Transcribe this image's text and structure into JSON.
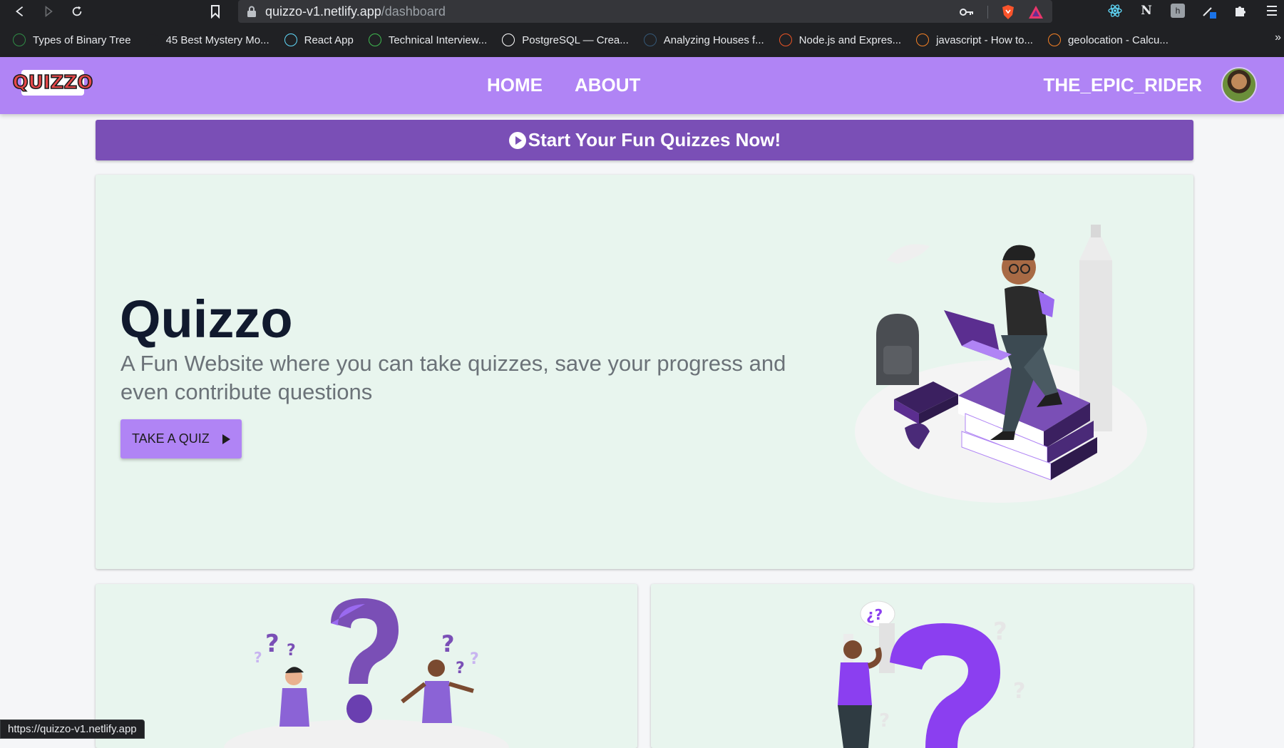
{
  "browser": {
    "url_host": "quizzo-v1.netlify.app",
    "url_path": "/dashboard",
    "bookmarks": [
      {
        "label": "Types of Binary Tree",
        "icon": "gfg-icon",
        "color": "#2f8d46"
      },
      {
        "label": "45 Best Mystery Mo...",
        "icon": "g-icon",
        "color": "#202124"
      },
      {
        "label": "React App",
        "icon": "react-icon",
        "color": "#61dafb"
      },
      {
        "label": "Technical Interview...",
        "icon": "tc-icon",
        "color": "#3fb950"
      },
      {
        "label": "PostgreSQL — Crea...",
        "icon": "medium-icon",
        "color": "#ffffff"
      },
      {
        "label": "Analyzing Houses f...",
        "icon": "tds-icon",
        "color": "#355876"
      },
      {
        "label": "Node.js and Expres...",
        "icon": "auth0-icon",
        "color": "#eb5424"
      },
      {
        "label": "javascript - How to...",
        "icon": "stackoverflow-icon",
        "color": "#f48024"
      },
      {
        "label": "geolocation - Calcu...",
        "icon": "stackoverflow-icon",
        "color": "#f48024"
      }
    ],
    "overflow": "»",
    "status_url": "https://quizzo-v1.netlify.app"
  },
  "header": {
    "logo": "QUIZZO",
    "nav": [
      "HOME",
      "ABOUT"
    ],
    "username": "THE_EPIC_RIDER"
  },
  "banner": {
    "label": "Start Your Fun Quizzes Now!"
  },
  "hero": {
    "title": "Quizzo",
    "subtitle": "A Fun Website where you can take quizzes, save your progress and even contribute questions",
    "button": "TAKE A QUIZ"
  },
  "colors": {
    "header": "#b084f5",
    "banner": "#7a4fb6",
    "card": "#e8f5ee",
    "title": "#111a2e"
  }
}
